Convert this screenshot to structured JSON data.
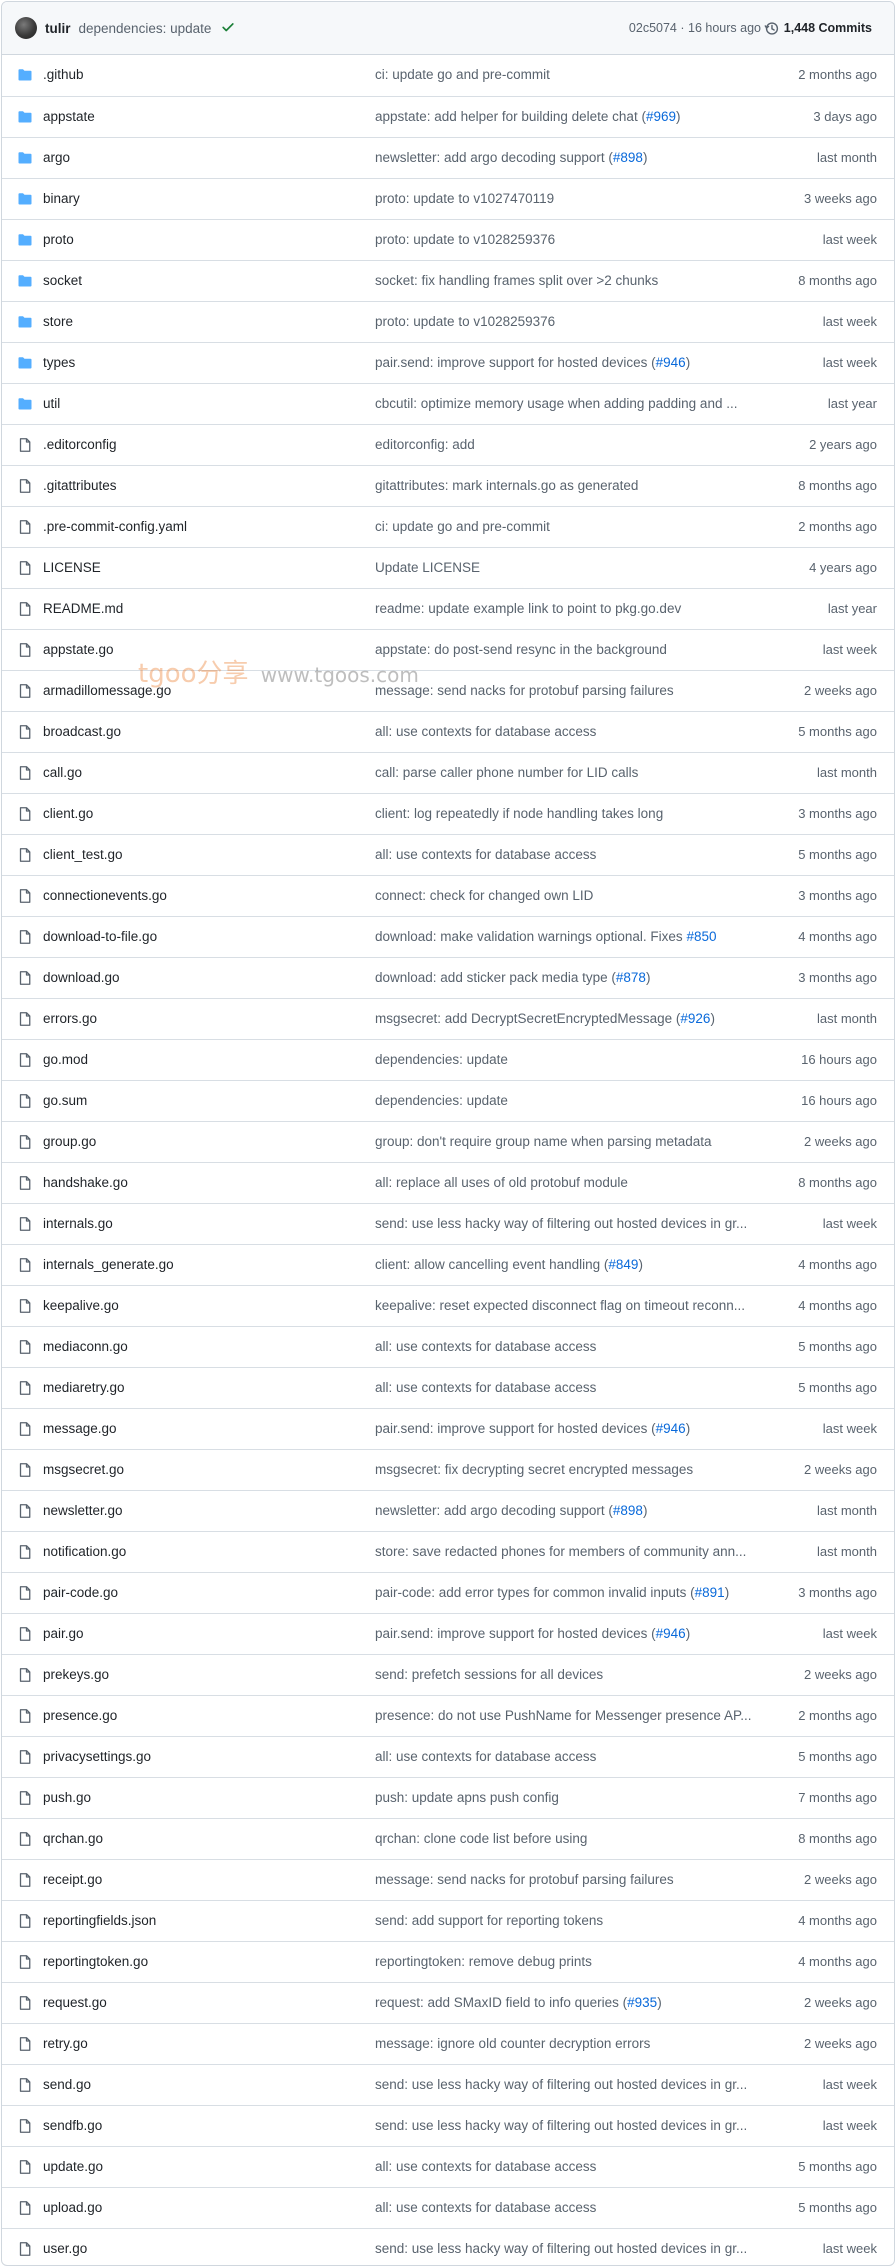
{
  "header": {
    "author": "tulir",
    "commit_message": "dependencies: update",
    "commit_hash": "02c5074",
    "time": "16 hours ago",
    "commits_label": "1,448 Commits"
  },
  "colors": {
    "folder": "#54aeff",
    "link": "#0969da",
    "check": "#1a7f37",
    "muted": "#59636e"
  },
  "files": [
    {
      "type": "dir",
      "name": ".github",
      "message": "ci: update go and pre-commit",
      "pr": "",
      "suffix": "",
      "age": "2 months ago"
    },
    {
      "type": "dir",
      "name": "appstate",
      "message": "appstate: add helper for building delete chat (",
      "pr": "#969",
      "suffix": ")",
      "age": "3 days ago"
    },
    {
      "type": "dir",
      "name": "argo",
      "message": "newsletter: add argo decoding support (",
      "pr": "#898",
      "suffix": ")",
      "age": "last month"
    },
    {
      "type": "dir",
      "name": "binary",
      "message": "proto: update to v1027470119",
      "pr": "",
      "suffix": "",
      "age": "3 weeks ago"
    },
    {
      "type": "dir",
      "name": "proto",
      "message": "proto: update to v1028259376",
      "pr": "",
      "suffix": "",
      "age": "last week"
    },
    {
      "type": "dir",
      "name": "socket",
      "message": "socket: fix handling frames split over >2 chunks",
      "pr": "",
      "suffix": "",
      "age": "8 months ago"
    },
    {
      "type": "dir",
      "name": "store",
      "message": "proto: update to v1028259376",
      "pr": "",
      "suffix": "",
      "age": "last week"
    },
    {
      "type": "dir",
      "name": "types",
      "message": "pair.send: improve support for hosted devices (",
      "pr": "#946",
      "suffix": ")",
      "age": "last week"
    },
    {
      "type": "dir",
      "name": "util",
      "message": "cbcutil: optimize memory usage when adding padding and ...",
      "pr": "",
      "suffix": "",
      "age": "last year"
    },
    {
      "type": "file",
      "name": ".editorconfig",
      "message": "editorconfig: add",
      "pr": "",
      "suffix": "",
      "age": "2 years ago"
    },
    {
      "type": "file",
      "name": ".gitattributes",
      "message": "gitattributes: mark internals.go as generated",
      "pr": "",
      "suffix": "",
      "age": "8 months ago"
    },
    {
      "type": "file",
      "name": ".pre-commit-config.yaml",
      "message": "ci: update go and pre-commit",
      "pr": "",
      "suffix": "",
      "age": "2 months ago"
    },
    {
      "type": "file",
      "name": "LICENSE",
      "message": "Update LICENSE",
      "pr": "",
      "suffix": "",
      "age": "4 years ago"
    },
    {
      "type": "file",
      "name": "README.md",
      "message": "readme: update example link to point to pkg.go.dev",
      "pr": "",
      "suffix": "",
      "age": "last year"
    },
    {
      "type": "file",
      "name": "appstate.go",
      "message": "appstate: do post-send resync in the background",
      "pr": "",
      "suffix": "",
      "age": "last week"
    },
    {
      "type": "file",
      "name": "armadillomessage.go",
      "message": "message: send nacks for protobuf parsing failures",
      "pr": "",
      "suffix": "",
      "age": "2 weeks ago"
    },
    {
      "type": "file",
      "name": "broadcast.go",
      "message": "all: use contexts for database access",
      "pr": "",
      "suffix": "",
      "age": "5 months ago"
    },
    {
      "type": "file",
      "name": "call.go",
      "message": "call: parse caller phone number for LID calls",
      "pr": "",
      "suffix": "",
      "age": "last month"
    },
    {
      "type": "file",
      "name": "client.go",
      "message": "client: log repeatedly if node handling takes long",
      "pr": "",
      "suffix": "",
      "age": "3 months ago"
    },
    {
      "type": "file",
      "name": "client_test.go",
      "message": "all: use contexts for database access",
      "pr": "",
      "suffix": "",
      "age": "5 months ago"
    },
    {
      "type": "file",
      "name": "connectionevents.go",
      "message": "connect: check for changed own LID",
      "pr": "",
      "suffix": "",
      "age": "3 months ago"
    },
    {
      "type": "file",
      "name": "download-to-file.go",
      "message": "download: make validation warnings optional. Fixes ",
      "pr": "#850",
      "suffix": "",
      "age": "4 months ago"
    },
    {
      "type": "file",
      "name": "download.go",
      "message": "download: add sticker pack media type (",
      "pr": "#878",
      "suffix": ")",
      "age": "3 months ago"
    },
    {
      "type": "file",
      "name": "errors.go",
      "message": "msgsecret: add DecryptSecretEncryptedMessage (",
      "pr": "#926",
      "suffix": ")",
      "age": "last month"
    },
    {
      "type": "file",
      "name": "go.mod",
      "message": "dependencies: update",
      "pr": "",
      "suffix": "",
      "age": "16 hours ago"
    },
    {
      "type": "file",
      "name": "go.sum",
      "message": "dependencies: update",
      "pr": "",
      "suffix": "",
      "age": "16 hours ago"
    },
    {
      "type": "file",
      "name": "group.go",
      "message": "group: don't require group name when parsing metadata",
      "pr": "",
      "suffix": "",
      "age": "2 weeks ago"
    },
    {
      "type": "file",
      "name": "handshake.go",
      "message": "all: replace all uses of old protobuf module",
      "pr": "",
      "suffix": "",
      "age": "8 months ago"
    },
    {
      "type": "file",
      "name": "internals.go",
      "message": "send: use less hacky way of filtering out hosted devices in gr...",
      "pr": "",
      "suffix": "",
      "age": "last week"
    },
    {
      "type": "file",
      "name": "internals_generate.go",
      "message": "client: allow cancelling event handling (",
      "pr": "#849",
      "suffix": ")",
      "age": "4 months ago"
    },
    {
      "type": "file",
      "name": "keepalive.go",
      "message": "keepalive: reset expected disconnect flag on timeout reconn...",
      "pr": "",
      "suffix": "",
      "age": "4 months ago"
    },
    {
      "type": "file",
      "name": "mediaconn.go",
      "message": "all: use contexts for database access",
      "pr": "",
      "suffix": "",
      "age": "5 months ago"
    },
    {
      "type": "file",
      "name": "mediaretry.go",
      "message": "all: use contexts for database access",
      "pr": "",
      "suffix": "",
      "age": "5 months ago"
    },
    {
      "type": "file",
      "name": "message.go",
      "message": "pair.send: improve support for hosted devices (",
      "pr": "#946",
      "suffix": ")",
      "age": "last week"
    },
    {
      "type": "file",
      "name": "msgsecret.go",
      "message": "msgsecret: fix decrypting secret encrypted messages",
      "pr": "",
      "suffix": "",
      "age": "2 weeks ago"
    },
    {
      "type": "file",
      "name": "newsletter.go",
      "message": "newsletter: add argo decoding support (",
      "pr": "#898",
      "suffix": ")",
      "age": "last month"
    },
    {
      "type": "file",
      "name": "notification.go",
      "message": "store: save redacted phones for members of community ann...",
      "pr": "",
      "suffix": "",
      "age": "last month"
    },
    {
      "type": "file",
      "name": "pair-code.go",
      "message": "pair-code: add error types for common invalid inputs (",
      "pr": "#891",
      "suffix": ")",
      "age": "3 months ago"
    },
    {
      "type": "file",
      "name": "pair.go",
      "message": "pair.send: improve support for hosted devices (",
      "pr": "#946",
      "suffix": ")",
      "age": "last week"
    },
    {
      "type": "file",
      "name": "prekeys.go",
      "message": "send: prefetch sessions for all devices",
      "pr": "",
      "suffix": "",
      "age": "2 weeks ago"
    },
    {
      "type": "file",
      "name": "presence.go",
      "message": "presence: do not use PushName for Messenger presence AP...",
      "pr": "",
      "suffix": "",
      "age": "2 months ago"
    },
    {
      "type": "file",
      "name": "privacysettings.go",
      "message": "all: use contexts for database access",
      "pr": "",
      "suffix": "",
      "age": "5 months ago"
    },
    {
      "type": "file",
      "name": "push.go",
      "message": "push: update apns push config",
      "pr": "",
      "suffix": "",
      "age": "7 months ago"
    },
    {
      "type": "file",
      "name": "qrchan.go",
      "message": "qrchan: clone code list before using",
      "pr": "",
      "suffix": "",
      "age": "8 months ago"
    },
    {
      "type": "file",
      "name": "receipt.go",
      "message": "message: send nacks for protobuf parsing failures",
      "pr": "",
      "suffix": "",
      "age": "2 weeks ago"
    },
    {
      "type": "file",
      "name": "reportingfields.json",
      "message": "send: add support for reporting tokens",
      "pr": "",
      "suffix": "",
      "age": "4 months ago"
    },
    {
      "type": "file",
      "name": "reportingtoken.go",
      "message": "reportingtoken: remove debug prints",
      "pr": "",
      "suffix": "",
      "age": "4 months ago"
    },
    {
      "type": "file",
      "name": "request.go",
      "message": "request: add SMaxID field to info queries (",
      "pr": "#935",
      "suffix": ")",
      "age": "2 weeks ago"
    },
    {
      "type": "file",
      "name": "retry.go",
      "message": "message: ignore old counter decryption errors",
      "pr": "",
      "suffix": "",
      "age": "2 weeks ago"
    },
    {
      "type": "file",
      "name": "send.go",
      "message": "send: use less hacky way of filtering out hosted devices in gr...",
      "pr": "",
      "suffix": "",
      "age": "last week"
    },
    {
      "type": "file",
      "name": "sendfb.go",
      "message": "send: use less hacky way of filtering out hosted devices in gr...",
      "pr": "",
      "suffix": "",
      "age": "last week"
    },
    {
      "type": "file",
      "name": "update.go",
      "message": "all: use contexts for database access",
      "pr": "",
      "suffix": "",
      "age": "5 months ago"
    },
    {
      "type": "file",
      "name": "upload.go",
      "message": "all: use contexts for database access",
      "pr": "",
      "suffix": "",
      "age": "5 months ago"
    },
    {
      "type": "file",
      "name": "user.go",
      "message": "send: use less hacky way of filtering out hosted devices in gr...",
      "pr": "",
      "suffix": "",
      "age": "last week"
    }
  ],
  "watermark": {
    "brand": "tgoo分享",
    "url": "www.tgoos.com"
  }
}
